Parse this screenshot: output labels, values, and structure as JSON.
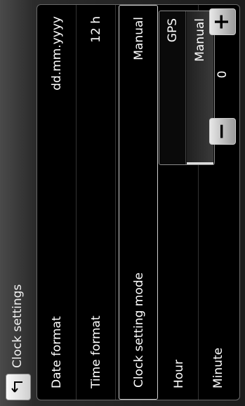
{
  "header": {
    "back_icon": "back-arrow-icon",
    "title": "Clock settings"
  },
  "rows": [
    {
      "label": "Date format",
      "value": "dd.mm.yyyy"
    },
    {
      "label": "Time format",
      "value": "12 h"
    },
    {
      "label": "Clock setting mode",
      "value": "Manual"
    },
    {
      "label": "Hour",
      "value": ""
    },
    {
      "label": "Minute",
      "value": ""
    }
  ],
  "dropdown": {
    "options": [
      "GPS",
      "Manual"
    ],
    "selected": "Manual"
  },
  "stepper": {
    "minus_label": "−",
    "plus_label": "+",
    "value": "0"
  }
}
